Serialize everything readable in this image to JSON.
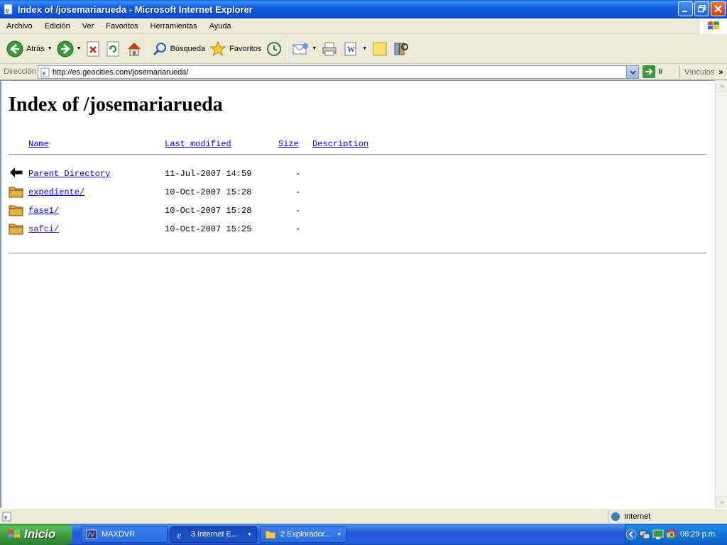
{
  "window": {
    "title": "Index of /josemariarueda - Microsoft Internet Explorer"
  },
  "menu": [
    "Archivo",
    "Edición",
    "Ver",
    "Favoritos",
    "Herramientas",
    "Ayuda"
  ],
  "toolbar": {
    "back_label": "Atrás",
    "search_label": "Búsqueda",
    "favorites_label": "Favoritos"
  },
  "address": {
    "label": "Dirección",
    "url": "http://es.geocities.com/josemariarueda/",
    "go_label": "Ir",
    "links_label": "Vínculos"
  },
  "page": {
    "title": "Index of /josemariarueda",
    "columns": {
      "name": "Name",
      "modified": "Last modified",
      "size": "Size",
      "description": "Description"
    },
    "rows": [
      {
        "name": "Parent Directory",
        "modified": "11-Jul-2007 14:59",
        "size": "-",
        "icon": "back-arrow-icon"
      },
      {
        "name": "expediente/",
        "modified": "10-Oct-2007 15:28",
        "size": "-",
        "icon": "folder-icon"
      },
      {
        "name": "fase1/",
        "modified": "10-Oct-2007 15:28",
        "size": "-",
        "icon": "folder-icon"
      },
      {
        "name": "safci/",
        "modified": "10-Oct-2007 15:25",
        "size": "-",
        "icon": "folder-icon"
      }
    ]
  },
  "status": {
    "zone": "Internet"
  },
  "taskbar": {
    "start_label": "Inicio",
    "tasks": [
      "MAXDVR",
      "3 Internet E...",
      "2 Explorador..."
    ],
    "clock": "06:29 p.m."
  },
  "colors": {
    "link": "#0000ee",
    "visited": "#551a8b",
    "titlebar": "#0a4fd0",
    "start": "#3a973a"
  }
}
